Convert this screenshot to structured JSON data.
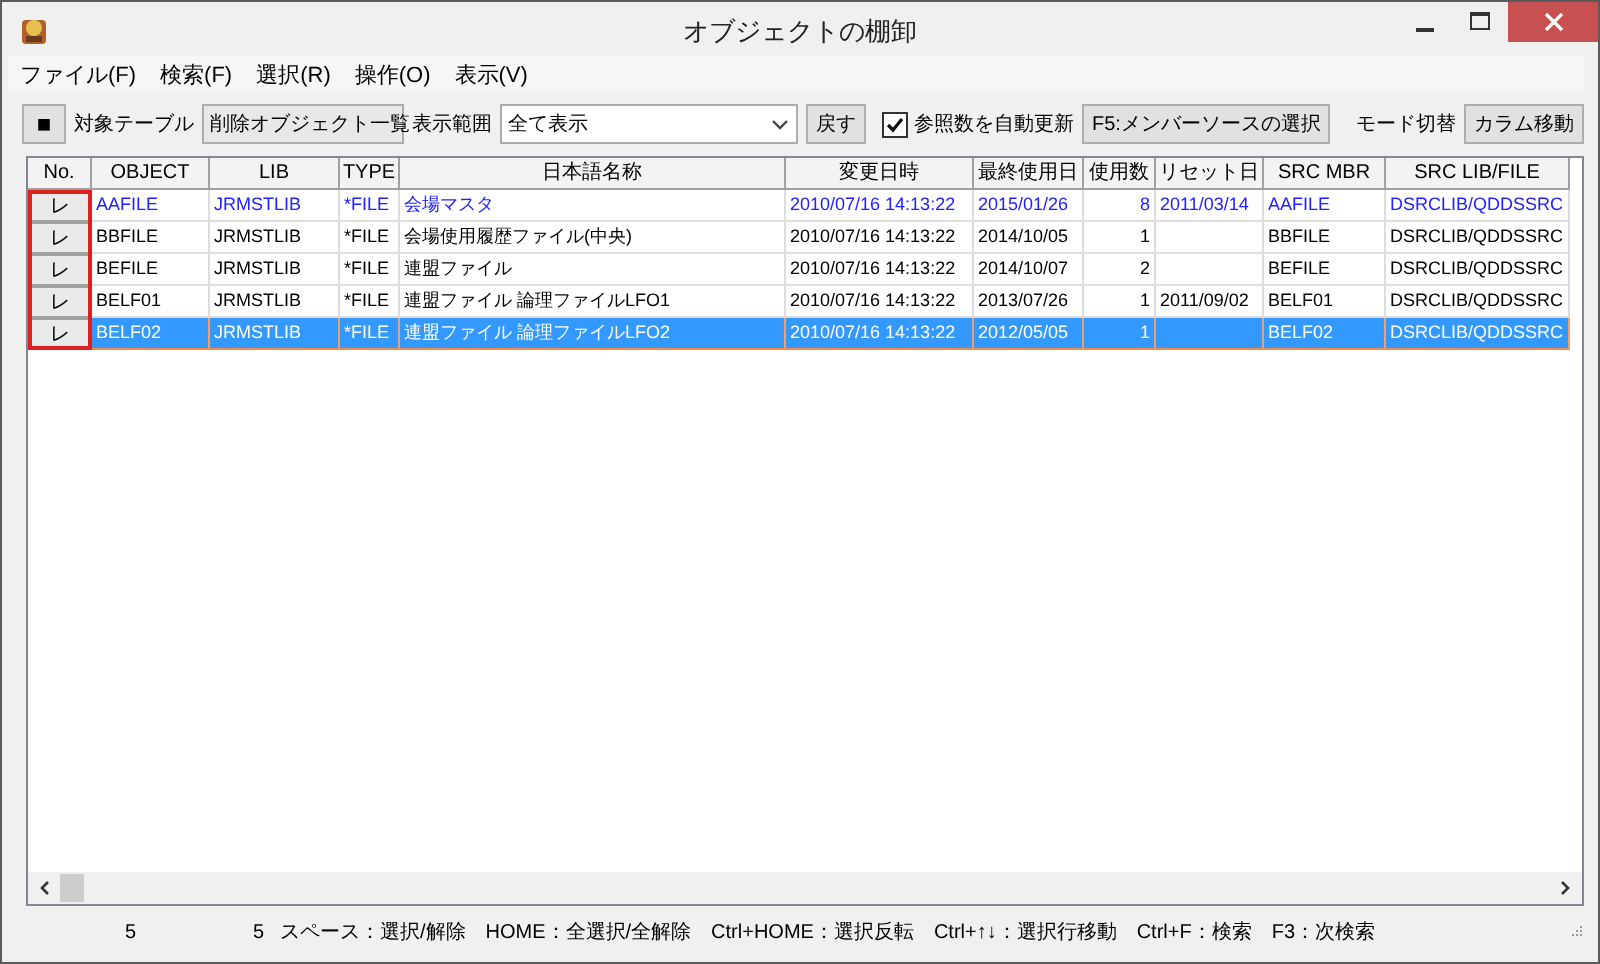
{
  "window": {
    "title": "オブジェクトの棚卸"
  },
  "menu": [
    "ファイル(F)",
    "検索(F)",
    "選択(R)",
    "操作(O)",
    "表示(V)"
  ],
  "toolbar": {
    "stop_button": "■",
    "table_label": "対象テーブル",
    "table_select": "削除オブジェクト一覧",
    "range_label": "表示範囲",
    "range_select": "全て表示",
    "back_button": "戻す",
    "auto_update": {
      "label": "参照数を自動更新",
      "checked": true
    },
    "member_button": "F5:メンバーソースの選択",
    "mode_label": "モード切替",
    "column_button": "カラム移動"
  },
  "table": {
    "columns": [
      "No.",
      "OBJECT",
      "LIB",
      "TYPE",
      "日本語名称",
      "変更日時",
      "最終使用日",
      "使用数",
      "リセット日",
      "SRC MBR",
      "SRC LIB/FILE"
    ],
    "rows": [
      {
        "selected": false,
        "color": "#2020ff",
        "cells": [
          "レ",
          "AAFILE",
          "JRMSTLIB",
          "*FILE",
          "会場マスタ",
          "2010/07/16 14:13:22",
          "2015/01/26",
          "8",
          "2011/03/14",
          "AAFILE",
          "DSRCLIB/QDDSSRC"
        ]
      },
      {
        "selected": false,
        "color": "#000000",
        "cells": [
          "レ",
          "BBFILE",
          "JRMSTLIB",
          "*FILE",
          "会場使用履歴ファイル(中央)",
          "2010/07/16 14:13:22",
          "2014/10/05",
          "1",
          "",
          "BBFILE",
          "DSRCLIB/QDDSSRC"
        ]
      },
      {
        "selected": false,
        "color": "#000000",
        "cells": [
          "レ",
          "BEFILE",
          "JRMSTLIB",
          "*FILE",
          "連盟ファイル",
          "2010/07/16 14:13:22",
          "2014/10/07",
          "2",
          "",
          "BEFILE",
          "DSRCLIB/QDDSSRC"
        ]
      },
      {
        "selected": false,
        "color": "#000000",
        "cells": [
          "レ",
          "BELF01",
          "JRMSTLIB",
          "*FILE",
          "連盟ファイル 論理ファイルLFO1",
          "2010/07/16 14:13:22",
          "2013/07/26",
          "1",
          "2011/09/02",
          "BELF01",
          "DSRCLIB/QDDSSRC"
        ]
      },
      {
        "selected": true,
        "cells": [
          "レ",
          "BELF02",
          "JRMSTLIB",
          "*FILE",
          "連盟ファイル 論理ファイルLFO2",
          "2010/07/16 14:13:22",
          "2012/05/05",
          "1",
          "",
          "BELF02",
          "DSRCLIB/QDDSSRC"
        ]
      }
    ]
  },
  "status_bar": {
    "count_1": "5",
    "count_2": "5",
    "help": "スペース：選択/解除　HOME：全選択/全解除　Ctrl+HOME：選択反転　Ctrl+↑↓：選択行移動　Ctrl+F：検索　F3：次検索"
  }
}
